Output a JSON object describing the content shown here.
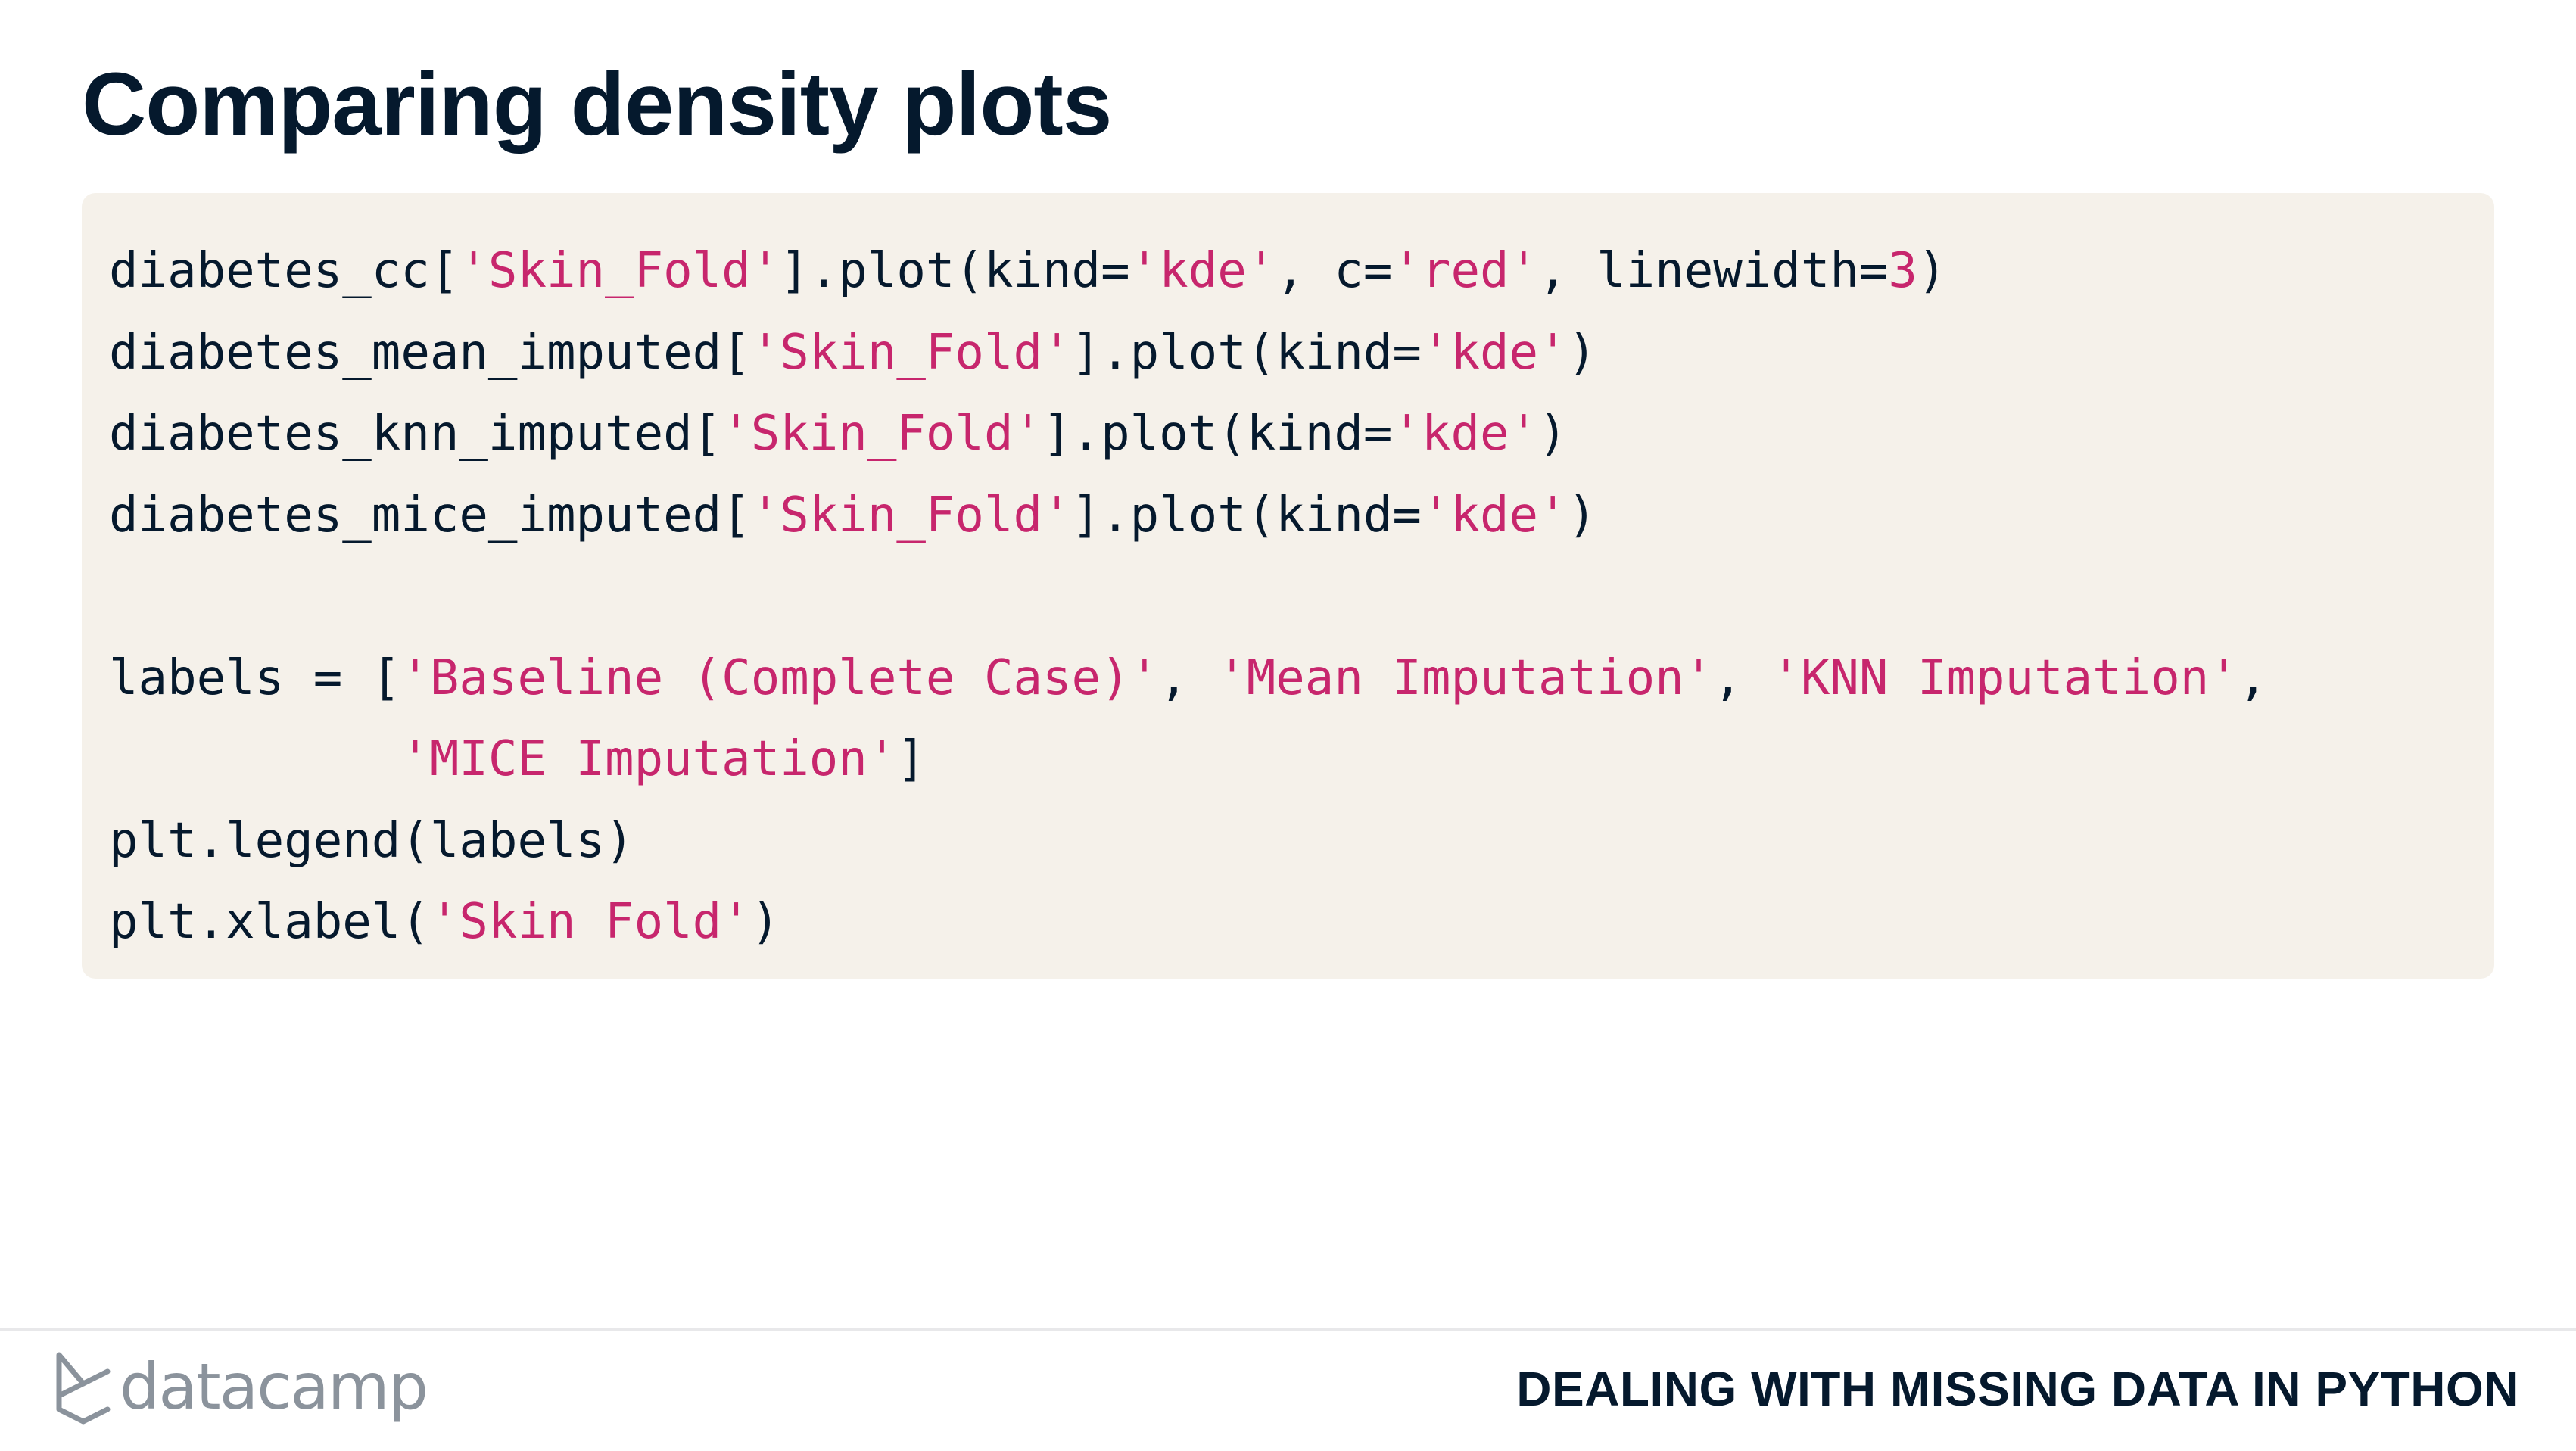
{
  "slide": {
    "title": "Comparing density plots"
  },
  "code": {
    "l1": [
      "diabetes_cc[",
      "'Skin_Fold'",
      "].plot(kind=",
      "'kde'",
      ", c=",
      "'red'",
      ", linewidth=",
      "3",
      ")"
    ],
    "l2": [
      "diabetes_mean_imputed[",
      "'Skin_Fold'",
      "].plot(kind=",
      "'kde'",
      ")"
    ],
    "l3": [
      "diabetes_knn_imputed[",
      "'Skin_Fold'",
      "].plot(kind=",
      "'kde'",
      ")"
    ],
    "l4": [
      "diabetes_mice_imputed[",
      "'Skin_Fold'",
      "].plot(kind=",
      "'kde'",
      ")"
    ],
    "l6": [
      "labels = [",
      "'Baseline (Complete Case)'",
      ", ",
      "'Mean Imputation'",
      ", ",
      "'KNN Imputation'",
      ","
    ],
    "l7": [
      "          ",
      "'MICE Imputation'",
      "]"
    ],
    "l8": [
      "plt.legend(labels)"
    ],
    "l9": [
      "plt.xlabel(",
      "'Skin Fold'",
      ")"
    ]
  },
  "footer": {
    "brand": "datacamp",
    "course_title": "DEALING WITH MISSING DATA IN PYTHON"
  },
  "colors": {
    "title": "#05192d",
    "code_bg": "#f5f1ea",
    "string": "#c7266d",
    "logo": "#8b939c"
  }
}
